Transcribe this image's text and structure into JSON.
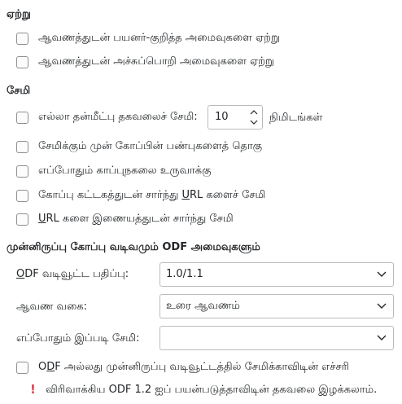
{
  "load": {
    "title": "ஏற்று",
    "items": [
      "ஆவணத்துடன் பயனர்-குறித்த அமைவுகளை ஏற்று",
      "ஆவணத்துடன் அச்சுப்பொறி அமைவுகளை ஏற்று"
    ]
  },
  "save": {
    "title": "சேமி",
    "autosave_label": "எல்லா தன்மீட்பு தகவலைச் சேமி:",
    "autosave_value": "10",
    "autosave_unit": "நிமிடங்கள்",
    "items": [
      "சேமிக்கும் முன் கோப்பின் பண்புகளைத் தொகு",
      "எப்போதும் காப்புநகலை உருவாக்கு",
      {
        "pre": "கோப்பு கட்டகத்துடன் சார்ந்து ",
        "accel": "U",
        "post": "RL களைச் சேமி"
      },
      {
        "pre": "",
        "accel": "U",
        "post": "RL களை இணையத்துடன் சார்ந்து சேமி"
      }
    ]
  },
  "defaults": {
    "title": "முன்னிருப்பு கோப்பு வடிவமும் ODF அமைவுகளும்",
    "odf_version_label": {
      "pre": "",
      "accel": "O",
      "post": "DF வடிவூட்ட பதிப்பு:"
    },
    "odf_version_value": "1.0/1.1",
    "doc_type_label": "ஆவண வகை:",
    "doc_type_value": "உரை ஆவணம்",
    "always_save_as_label": "எப்போதும் இப்படி சேமி:",
    "always_save_as_value": "",
    "warn_label": {
      "pre": "O",
      "accel": "D",
      "post": "F அல்லது முன்னிருப்பு வடிவூட்டத்தில் சேமிக்காவிடின் எச்சரி"
    },
    "warning_text": "விரிவாக்கிய ODF 1.2 ஐப் பயன்படுத்தாவிடின் தகவலை இழக்கலாம்."
  },
  "colors": {
    "warning": "#da4453",
    "border": "#b9bbbd"
  },
  "icons": {
    "warning": "exclamation-icon",
    "spin": "spin-arrows-icon",
    "dropdown": "chevron-down-icon"
  }
}
